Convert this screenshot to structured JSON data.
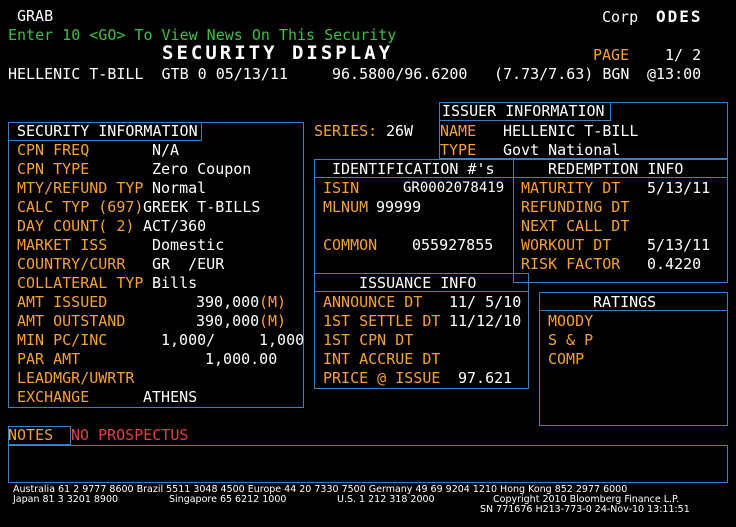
{
  "header": {
    "grab": "GRAB",
    "corp": "Corp",
    "odes": "ODES",
    "enter_line": "Enter 10 <GO> To View News On This Security",
    "title": "SECURITY DISPLAY",
    "page_label": "PAGE",
    "page_num": "1/ 2",
    "security_line": "HELLENIC T-BILL  GTB 0 05/13/11",
    "price": "96.5800/96.6200",
    "yield": "(7.73/7.63) BGN",
    "time": "@13:00"
  },
  "series": {
    "label": "SERIES:",
    "value": "26W"
  },
  "security_info": {
    "title": "SECURITY INFORMATION",
    "rows": [
      {
        "label": "CPN FREQ",
        "value": "N/A"
      },
      {
        "label": "CPN TYPE",
        "value": "Zero Coupon"
      },
      {
        "label": "MTY/REFUND TYP",
        "value": "Normal"
      },
      {
        "label": "CALC TYP (697)",
        "value": "GREEK T-BILLS"
      },
      {
        "label": "DAY COUNT( 2)",
        "value": "ACT/360"
      },
      {
        "label": "MARKET ISS",
        "value": "Domestic"
      },
      {
        "label": "COUNTRY/CURR",
        "value": "GR  /EUR"
      },
      {
        "label": "COLLATERAL TYP",
        "value": "Bills"
      },
      {
        "label": "AMT ISSUED",
        "value": "390,000",
        "suffix": "(M)"
      },
      {
        "label": "AMT OUTSTAND",
        "value": "390,000",
        "suffix": "(M)"
      },
      {
        "label": "MIN PC/INC",
        "value": "1,000/",
        "value2": "1,000"
      },
      {
        "label": "PAR AMT",
        "value": "1,000.00"
      },
      {
        "label": "LEADMGR/UWRTR",
        "value": ""
      },
      {
        "label": "EXCHANGE",
        "value": "ATHENS"
      }
    ]
  },
  "issuer_info": {
    "title": "ISSUER INFORMATION",
    "name_label": "NAME",
    "name_value": "HELLENIC T-BILL",
    "type_label": "TYPE",
    "type_value": "Govt National"
  },
  "identification": {
    "title": "IDENTIFICATION #'s",
    "isin_label": "ISIN",
    "isin_value": "GR0002078419",
    "mlnum_label": "MLNUM",
    "mlnum_value": "99999",
    "common_label": "COMMON",
    "common_value": "055927855"
  },
  "redemption": {
    "title": "REDEMPTION INFO",
    "rows": [
      {
        "label": "MATURITY DT",
        "value": "5/13/11"
      },
      {
        "label": "REFUNDING DT",
        "value": ""
      },
      {
        "label": "NEXT CALL DT",
        "value": ""
      },
      {
        "label": "WORKOUT DT",
        "value": "5/13/11"
      },
      {
        "label": "RISK FACTOR",
        "value": "0.4220"
      }
    ]
  },
  "issuance": {
    "title": "ISSUANCE INFO",
    "rows": [
      {
        "label": "ANNOUNCE DT",
        "value": "11/ 5/10"
      },
      {
        "label": "1ST SETTLE DT",
        "value": "11/12/10"
      },
      {
        "label": "1ST CPN DT",
        "value": ""
      },
      {
        "label": "INT ACCRUE DT",
        "value": ""
      },
      {
        "label": "PRICE @ ISSUE",
        "value": "97.621"
      }
    ]
  },
  "ratings": {
    "title": "RATINGS",
    "agencies": [
      "MOODY",
      "S & P",
      "COMP"
    ]
  },
  "notes": {
    "label": "NOTES",
    "value": "NO PROSPECTUS"
  },
  "footer": {
    "line1": "Australia 61 2 9777 8600 Brazil 5511 3048 4500 Europe 44 20 7330 7500 Germany 49 69 9204 1210 Hong Kong 852 2977 6000",
    "line2a": "Japan 81 3 3201 8900",
    "line2b": "Singapore 65 6212 1000",
    "line2c": "U.S. 1 212 318 2000",
    "line2d": "Copyright 2010 Bloomberg Finance L.P.",
    "line3": "SN 771676 H213-773-0 24-Nov-10 13:11:51"
  },
  "colors": {
    "orange": "#f5a033",
    "green": "#3fbf3f",
    "border": "#3a7fc0",
    "background": "#000000"
  }
}
